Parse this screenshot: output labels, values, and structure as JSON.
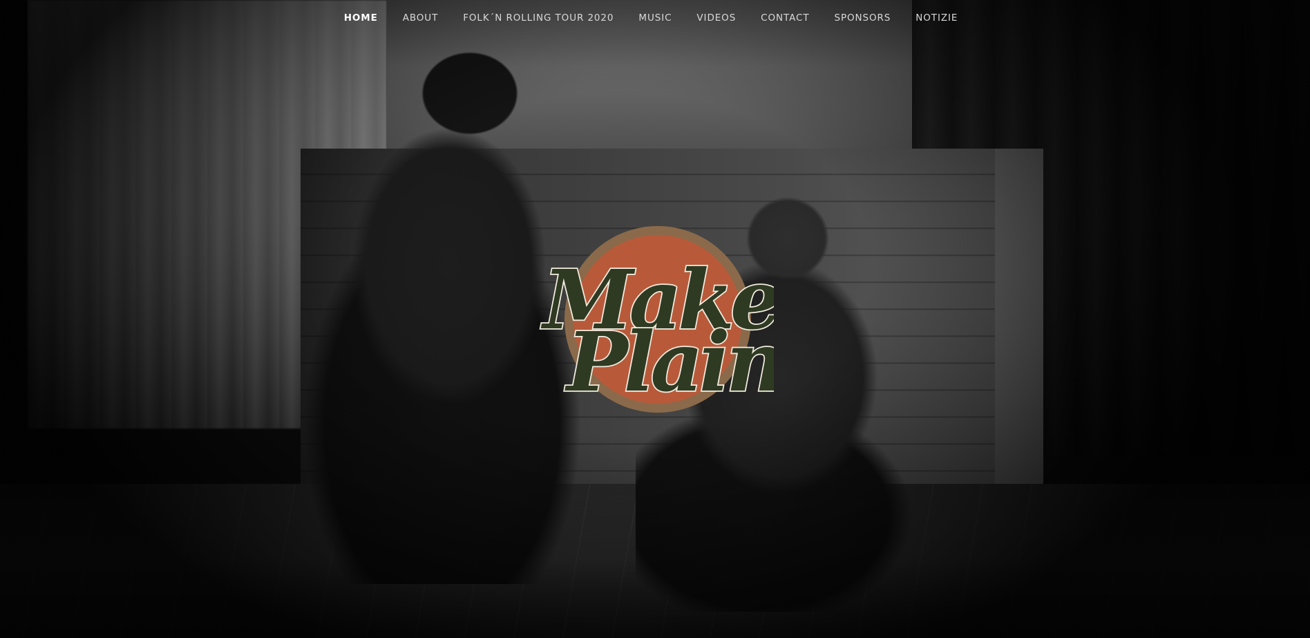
{
  "nav": {
    "items": [
      {
        "label": "HOME",
        "active": true
      },
      {
        "label": "ABOUT",
        "active": false
      },
      {
        "label": "FOLK´N ROLLING TOUR 2020",
        "active": false
      },
      {
        "label": "MUSIC",
        "active": false
      },
      {
        "label": "VIDEOS",
        "active": false
      },
      {
        "label": "CONTACT",
        "active": false
      },
      {
        "label": "SPONSORS",
        "active": false
      },
      {
        "label": "NOTIZIE",
        "active": false
      }
    ]
  },
  "logo": {
    "line1": "Make",
    "line2": "Plain",
    "colors": {
      "disc_outer": "#8a6a4a",
      "disc_inner": "#b85a3a",
      "lettering": "#2f3a22",
      "outline": "#f2ede0"
    }
  }
}
